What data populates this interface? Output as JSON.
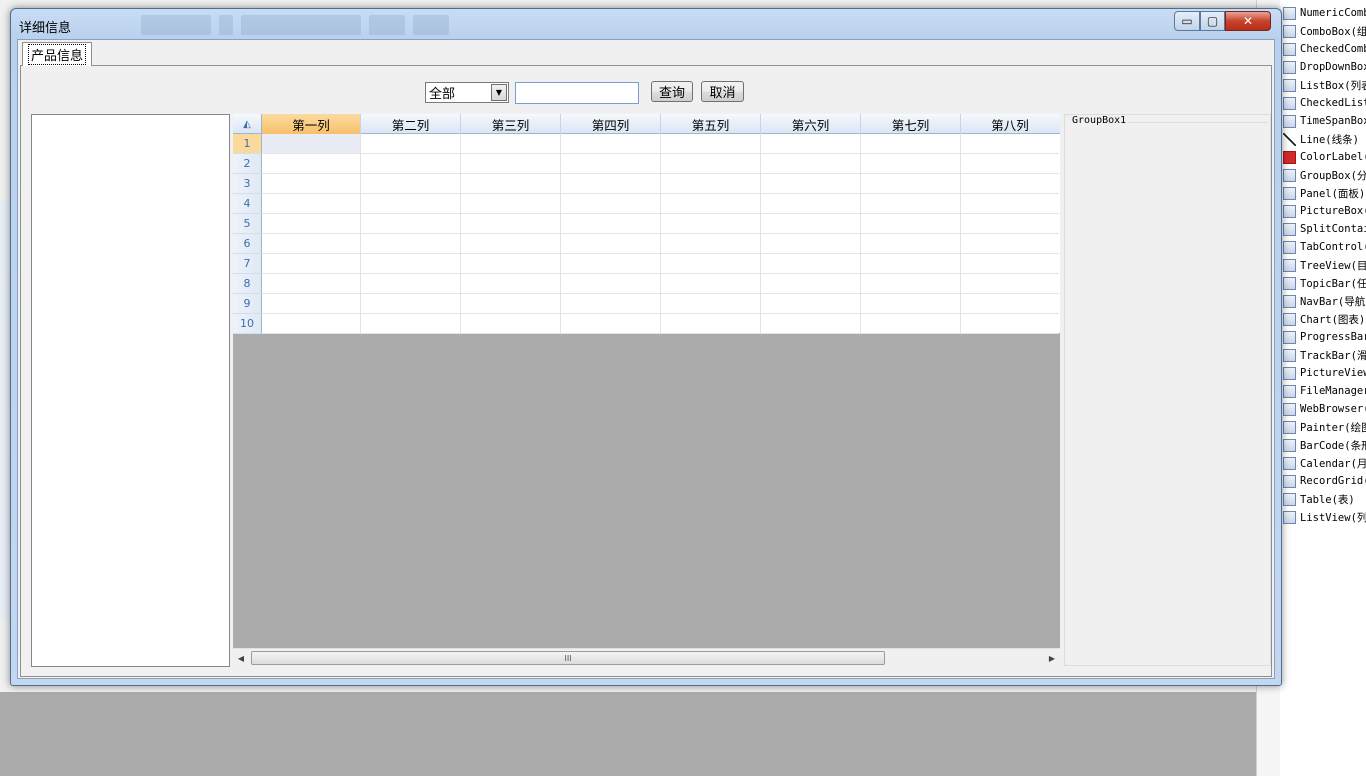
{
  "window": {
    "title": "详细信息",
    "min_glyph": "▭",
    "max_glyph": "▢",
    "close_glyph": "✕"
  },
  "tab": {
    "label": "产品信息"
  },
  "search": {
    "scope_value": "全部",
    "input_value": "",
    "query_label": "查询",
    "cancel_label": "取消"
  },
  "grid": {
    "columns": [
      "第一列",
      "第二列",
      "第三列",
      "第四列",
      "第五列",
      "第六列",
      "第七列",
      "第八列"
    ],
    "rows": [
      "1",
      "2",
      "3",
      "4",
      "5",
      "6",
      "7",
      "8",
      "9",
      "10"
    ],
    "corner_glyph": "◭",
    "scroll_thumb_glyph": "III"
  },
  "groupbox": {
    "label": "GroupBox1"
  },
  "toolbox": {
    "items": [
      {
        "label": "NumericComb",
        "icon": "numeric-combo-icon"
      },
      {
        "label": "ComboBox(组",
        "icon": "combobox-icon"
      },
      {
        "label": "CheckedComb",
        "icon": "checked-combo-icon"
      },
      {
        "label": "DropDownBox",
        "icon": "dropdown-icon"
      },
      {
        "label": "ListBox(列表",
        "icon": "listbox-icon"
      },
      {
        "label": "CheckedList",
        "icon": "checked-list-icon"
      },
      {
        "label": "TimeSpanBox",
        "icon": "timespan-icon"
      },
      {
        "label": "Line(线条)",
        "icon": "line-icon"
      },
      {
        "label": "ColorLabel(",
        "icon": "color-label-icon"
      },
      {
        "label": "GroupBox(分",
        "icon": "groupbox-icon"
      },
      {
        "label": "Panel(面板)",
        "icon": "panel-icon"
      },
      {
        "label": "PictureBox(",
        "icon": "picturebox-icon"
      },
      {
        "label": "SplitContai",
        "icon": "split-container-icon"
      },
      {
        "label": "TabControl(",
        "icon": "tabcontrol-icon"
      },
      {
        "label": "TreeView(目",
        "icon": "treeview-icon"
      },
      {
        "label": "TopicBar(任",
        "icon": "topicbar-icon"
      },
      {
        "label": "NavBar(导航",
        "icon": "navbar-icon"
      },
      {
        "label": "Chart(图表)",
        "icon": "chart-icon"
      },
      {
        "label": "ProgressBar",
        "icon": "progressbar-icon"
      },
      {
        "label": "TrackBar(滑",
        "icon": "trackbar-icon"
      },
      {
        "label": "PictureView",
        "icon": "pictureview-icon"
      },
      {
        "label": "FileManager",
        "icon": "filemanager-icon"
      },
      {
        "label": "WebBrowser(",
        "icon": "webbrowser-icon"
      },
      {
        "label": "Painter(绘图",
        "icon": "painter-icon"
      },
      {
        "label": "BarCode(条形",
        "icon": "barcode-icon"
      },
      {
        "label": "Calendar(月",
        "icon": "calendar-icon"
      },
      {
        "label": "RecordGrid(",
        "icon": "recordgrid-icon"
      },
      {
        "label": "Table(表)",
        "icon": "table-icon"
      },
      {
        "label": "ListView(列",
        "icon": "listview-icon"
      }
    ]
  },
  "colors": {
    "selected_header": "#f7c06a",
    "close_button": "#c8432e",
    "grid_empty_area": "#ababab"
  }
}
